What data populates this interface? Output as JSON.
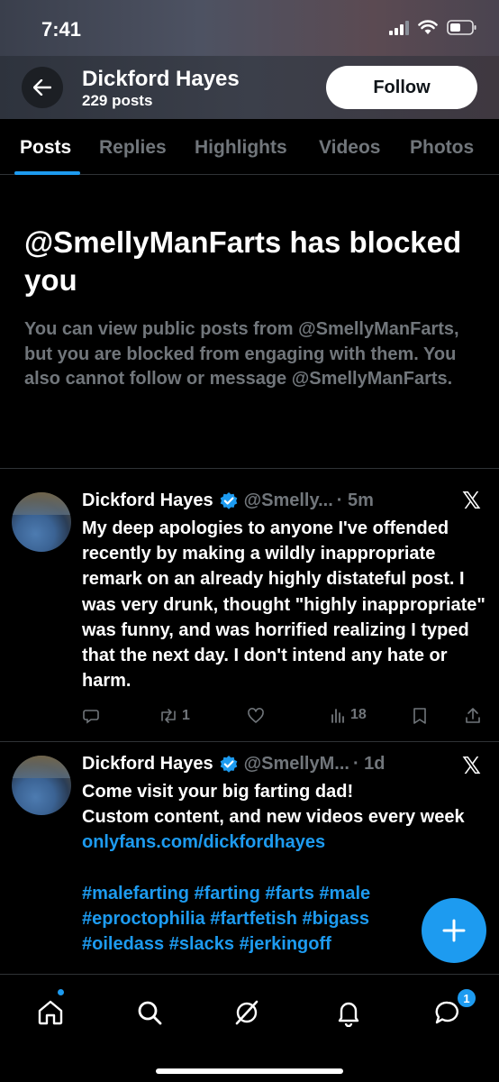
{
  "status_bar": {
    "time": "7:41"
  },
  "header": {
    "profile_name": "Dickford Hayes",
    "post_count": "229 posts",
    "follow_label": "Follow"
  },
  "tabs": [
    {
      "label": "Posts",
      "active": true
    },
    {
      "label": "Replies",
      "active": false
    },
    {
      "label": "Highlights",
      "active": false
    },
    {
      "label": "Videos",
      "active": false
    },
    {
      "label": "Photos",
      "active": false
    }
  ],
  "blocked": {
    "title": "@SmellyManFarts has blocked you",
    "body": "You can view public posts from @SmellyManFarts, but you are blocked from engaging with them. You also cannot follow or message @SmellyManFarts."
  },
  "tweets": [
    {
      "name": "Dickford Hayes",
      "handle": "@Smelly...",
      "time": "· 5m",
      "text": "My deep apologies to anyone I've offended recently by making a wildly inappropriate remark on an already highly distateful post. I was very drunk, thought \"highly inappropriate\" was funny, and was horrified realizing I typed that the next day. I don't intend any hate or harm.",
      "retweets": "1",
      "views": "18"
    },
    {
      "name": "Dickford Hayes",
      "handle": "@SmellyM...",
      "time": "· 1d",
      "text_line1": "Come visit your big farting dad!",
      "text_line2": "Custom content, and new videos every week",
      "link": "onlyfans.com/dickfordhayes",
      "hashtags_1": "#malefarting #farting #farts #male",
      "hashtags_2": "#eproctophilia #fartfetish #bigass",
      "hashtags_3": "#oiledass #slacks #jerkingoff"
    }
  ],
  "bottom_nav": {
    "messages_badge": "1"
  },
  "colors": {
    "accent": "#1d9bf0",
    "background": "#000000",
    "muted_text": "#71767b"
  }
}
